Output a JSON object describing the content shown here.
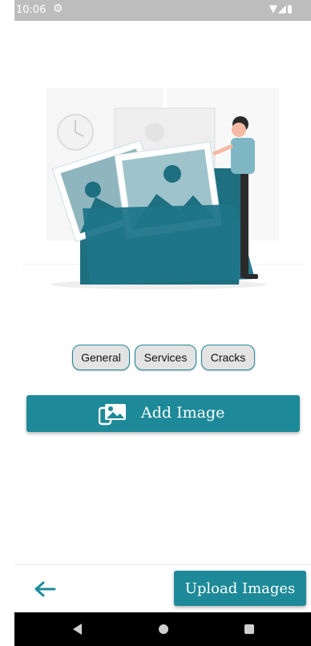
{
  "status_bar": {
    "time": "10:06",
    "gear_icon": "gear-icon",
    "right_icons": "▼◢▮"
  },
  "illustration": {
    "name": "folder-photos-illustration",
    "accent": "#1e7a8c"
  },
  "categories": {
    "general": "General",
    "services": "Services",
    "cracks": "Cracks"
  },
  "add_image": {
    "label": "Add Image",
    "icon": "image-add-icon"
  },
  "footer": {
    "back_icon": "arrow-left-icon",
    "upload_label": "Upload Images"
  },
  "colors": {
    "primary": "#1e8a99",
    "chip_bg": "#e3e3e3"
  }
}
